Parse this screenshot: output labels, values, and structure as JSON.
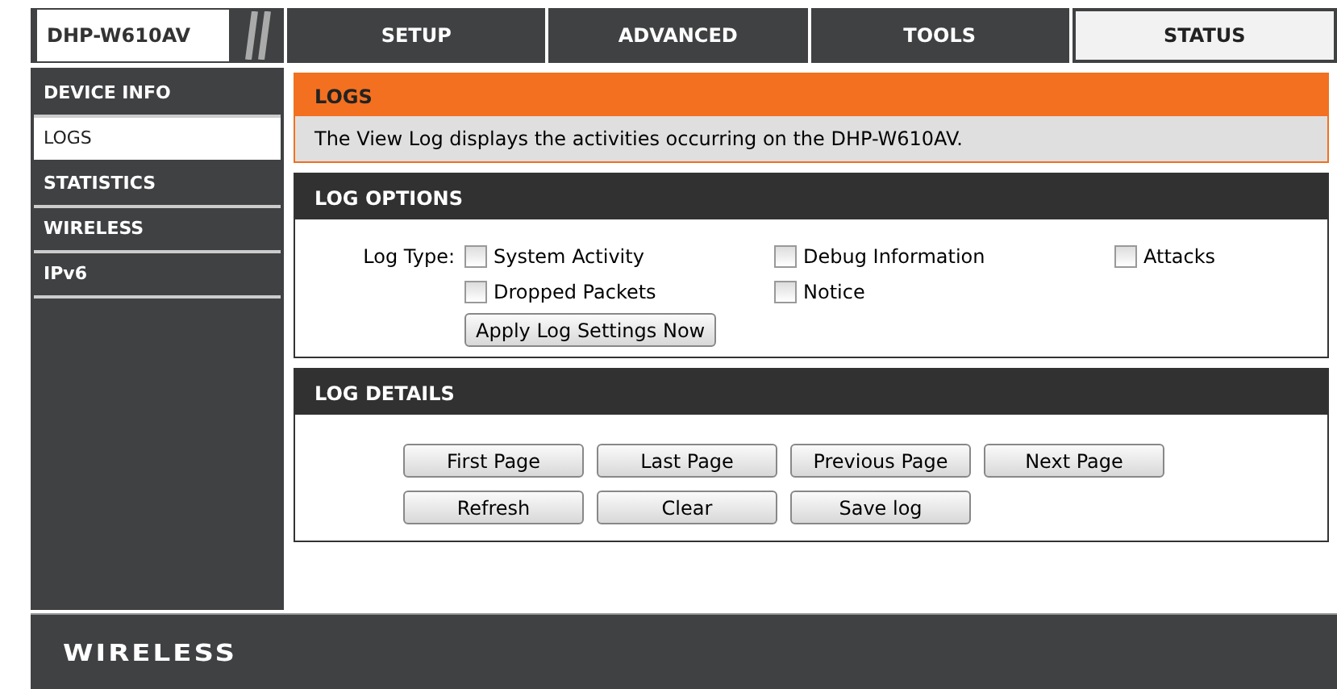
{
  "header": {
    "model": "DHP-W610AV",
    "tabs": [
      {
        "label": "SETUP",
        "selected": false
      },
      {
        "label": "ADVANCED",
        "selected": false
      },
      {
        "label": "TOOLS",
        "selected": false
      },
      {
        "label": "STATUS",
        "selected": true
      }
    ]
  },
  "sidebar": {
    "items": [
      {
        "label": "DEVICE INFO",
        "selected": false
      },
      {
        "label": "LOGS",
        "selected": true
      },
      {
        "label": "STATISTICS",
        "selected": false
      },
      {
        "label": "WIRELESS",
        "selected": false
      },
      {
        "label": "IPv6",
        "selected": false
      }
    ]
  },
  "intro": {
    "title": "LOGS",
    "text": "The View Log displays the activities occurring on the DHP-W610AV."
  },
  "log_options": {
    "title": "LOG OPTIONS",
    "label": "Log Type:",
    "options": [
      {
        "label": "System Activity",
        "checked": false
      },
      {
        "label": "Debug Information",
        "checked": false
      },
      {
        "label": "Attacks",
        "checked": false
      },
      {
        "label": "Dropped Packets",
        "checked": false
      },
      {
        "label": "Notice",
        "checked": false
      }
    ],
    "apply_button": "Apply Log Settings Now"
  },
  "log_details": {
    "title": "LOG DETAILS",
    "buttons": [
      "First Page",
      "Last Page",
      "Previous Page",
      "Next Page",
      "Refresh",
      "Clear",
      "Save log"
    ]
  },
  "footer": {
    "brand": "WIRELESS"
  }
}
